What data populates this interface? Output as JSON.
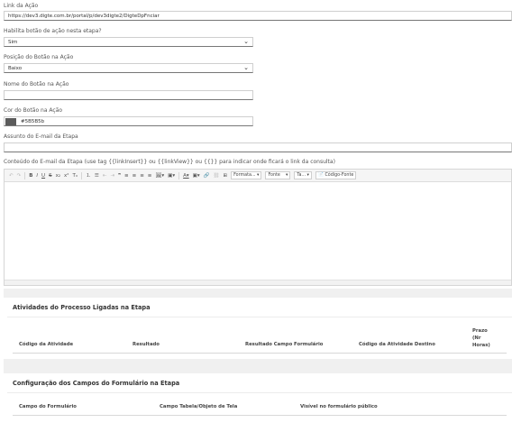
{
  "fields": {
    "link_label": "Link da Ação",
    "link_value": "https://dev3.digte.com.br/portal/p/dev3digte2/DigteDpFnciar",
    "habilita_label": "Habilita botão de ação nesta etapa?",
    "habilita_value": "Sim",
    "posicao_label": "Posição do Botão na Ação",
    "posicao_value": "Baixo",
    "nome_label": "Nome do Botão na Ação",
    "nome_value": "",
    "cor_label": "Cor do Botão na Ação",
    "cor_value": "#5B5B5b",
    "cor_swatch": "#5b5b5b",
    "assunto_label": "Assunto do E-mail da Etapa",
    "assunto_value": "",
    "conteudo_label": "Conteúdo do E-mail da Etapa (use tag {{linkInsert}} ou {{linkView}} ou {{}} para indicar onde ficará o link da consulta)"
  },
  "toolbar": {
    "undo": "↶",
    "redo": "↷",
    "bold": "B",
    "italic": "I",
    "underline": "U",
    "strike": "S",
    "subscript": "x₂",
    "superscript": "x²",
    "remove_format": "Tₓ",
    "numbered_list": "⒈",
    "bullet_list": "☰",
    "outdent": "⇤",
    "indent": "⇥",
    "blockquote": "❞",
    "align_left": "≡",
    "align_center": "≡",
    "align_right": "≡",
    "justify": "≡",
    "image": "🖼▾",
    "media": "▣▾",
    "text_color": "A▾",
    "bg_color": "▣▾",
    "link": "🔗",
    "unlink": "⛓",
    "table": "⊞",
    "format": "Formata...",
    "font": "Fonte",
    "size": "Ta...",
    "source": "Código-Fonte"
  },
  "atividades": {
    "title": "Atividades do Processo Ligadas na Etapa",
    "columns": [
      "Código da Atividade",
      "Resultado",
      "Resultado Campo Formulário",
      "Código da Atividade Destino"
    ],
    "prazo": [
      "Prazo",
      "(Nr",
      "Horas)"
    ]
  },
  "configuracao": {
    "title": "Configuração dos Campos do Formulário na Etapa",
    "columns": [
      "Campo do Formulário",
      "Campo Tabela/Objeto de Tela",
      "Visível no formulário público"
    ]
  }
}
